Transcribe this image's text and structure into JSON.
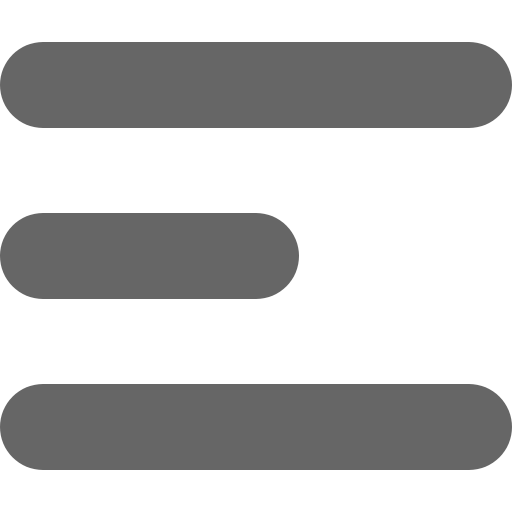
{
  "icon": {
    "name": "menu-align-left-icon",
    "color": "#666666",
    "background": "#ffffff"
  }
}
